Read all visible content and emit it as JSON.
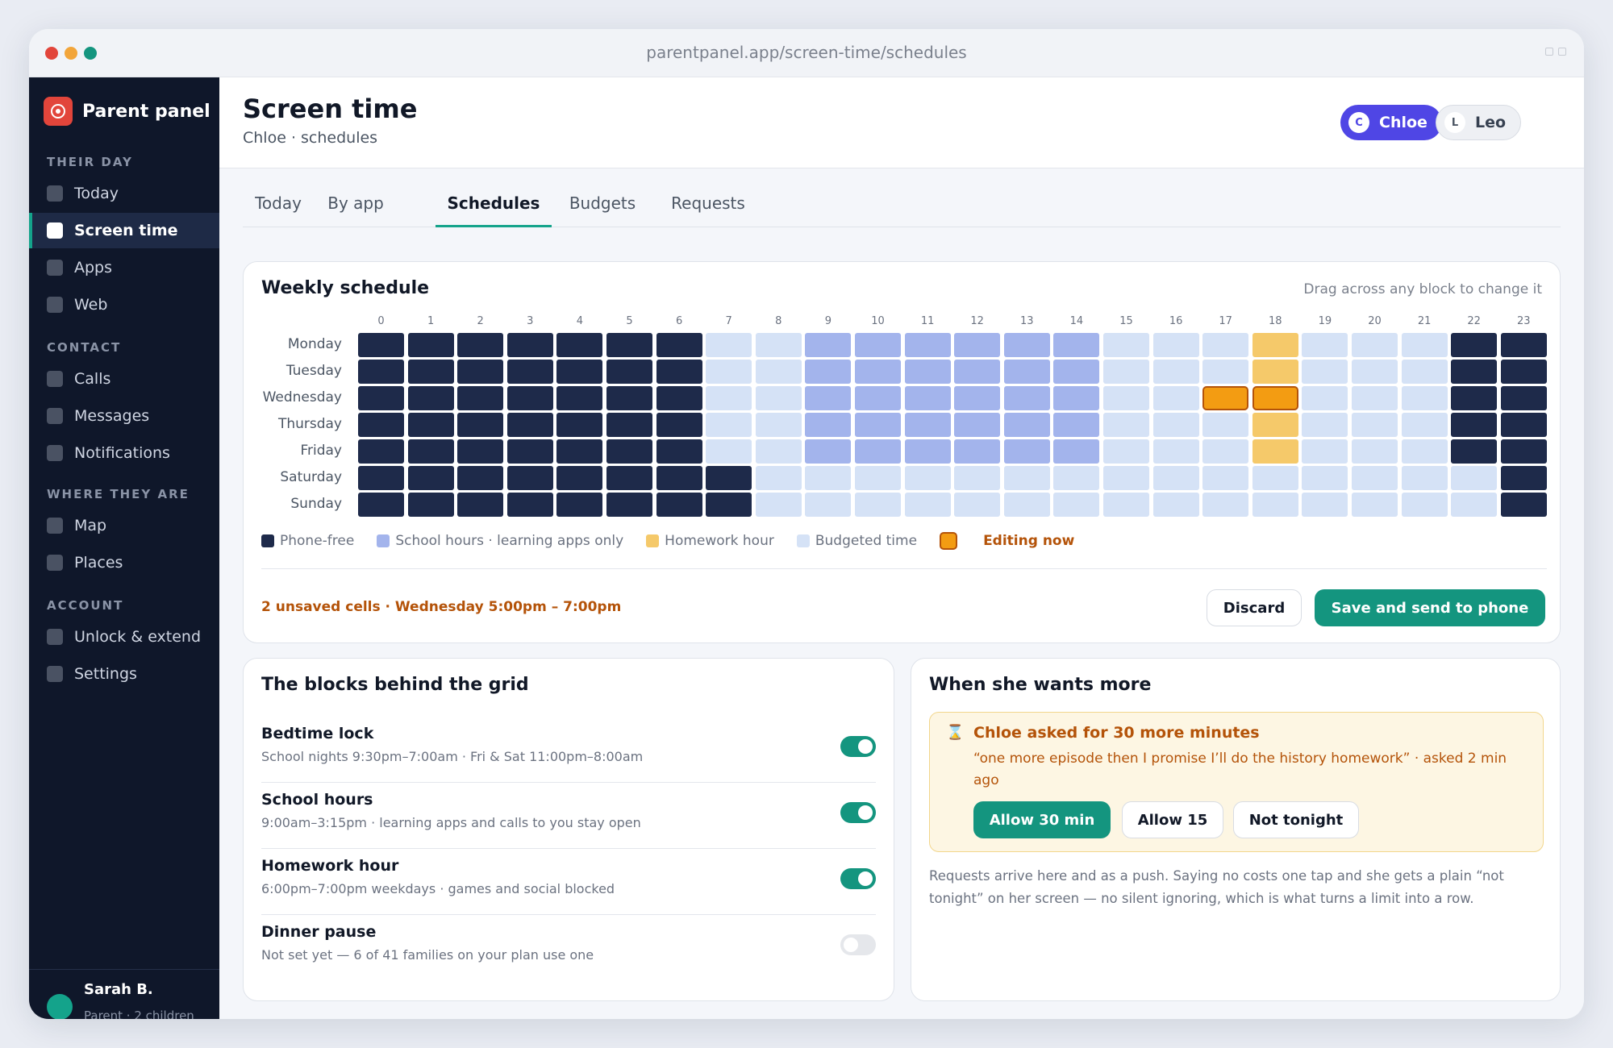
{
  "browser": {
    "url": "parentpanel.app/screen-time/schedules"
  },
  "app": {
    "name": "Parent panel"
  },
  "sidebar": {
    "sections": [
      {
        "title": "THEIR DAY",
        "items": [
          {
            "label": "Today"
          },
          {
            "label": "Screen time",
            "active": true
          },
          {
            "label": "Apps"
          },
          {
            "label": "Web"
          }
        ]
      },
      {
        "title": "CONTACT",
        "items": [
          {
            "label": "Calls"
          },
          {
            "label": "Messages"
          },
          {
            "label": "Notifications"
          }
        ]
      },
      {
        "title": "WHERE THEY ARE",
        "items": [
          {
            "label": "Map"
          },
          {
            "label": "Places"
          }
        ]
      },
      {
        "title": "ACCOUNT",
        "items": [
          {
            "label": "Unlock & extend"
          },
          {
            "label": "Settings"
          }
        ]
      }
    ],
    "user": {
      "name": "Sarah B.",
      "role": "Parent · 2 children"
    }
  },
  "header": {
    "title": "Screen time",
    "subtitle": "Chloe · schedules",
    "children": [
      {
        "initial": "C",
        "name": "Chloe",
        "selected": true
      },
      {
        "initial": "L",
        "name": "Leo",
        "selected": false
      }
    ]
  },
  "tabs": [
    {
      "label": "Today"
    },
    {
      "label": "By app"
    },
    {
      "label": "Schedules",
      "active": true
    },
    {
      "label": "Budgets"
    },
    {
      "label": "Requests"
    }
  ],
  "schedule": {
    "title": "Weekly schedule",
    "hint": "Drag across any block to change it",
    "hours": [
      "0",
      "1",
      "2",
      "3",
      "4",
      "5",
      "6",
      "7",
      "8",
      "9",
      "10",
      "11",
      "12",
      "13",
      "14",
      "15",
      "16",
      "17",
      "18",
      "19",
      "20",
      "21",
      "22",
      "23"
    ],
    "days": [
      "Monday",
      "Tuesday",
      "Wednesday",
      "Thursday",
      "Friday",
      "Saturday",
      "Sunday"
    ],
    "rows": [
      "PPPPPPPBBSSSSSSBBBHBBBPP",
      "PPPPPPPBBSSSSSSBBBHBBBPP",
      "PPPPPPPBBSSSSSSBBEEBBBPP",
      "PPPPPPPBBSSSSSSBBBHBBBPP",
      "PPPPPPPBBSSSSSSBBBHBBBPP",
      "PPPPPPPPBBBBBBBBBBBBBBBP",
      "PPPPPPPPBBBBBBBBBBBBBBBP"
    ],
    "legend": [
      {
        "key": "P",
        "label": "Phone-free",
        "color": "#1e2a4a"
      },
      {
        "key": "S",
        "label": "School hours · learning apps only",
        "color": "#a3b4ec"
      },
      {
        "key": "H",
        "label": "Homework hour",
        "color": "#f5c96a"
      },
      {
        "key": "B",
        "label": "Budgeted time",
        "color": "#d5e2f6"
      },
      {
        "key": "E",
        "label": "Editing now",
        "color": "#f39c12"
      }
    ],
    "unsaved": "2 unsaved cells · Wednesday 5:00pm – 7:00pm",
    "discard_label": "Discard",
    "save_label": "Save and send to phone"
  },
  "blocks": {
    "title": "The blocks behind the grid",
    "items": [
      {
        "name": "Bedtime lock",
        "detail": "School nights 9:30pm–7:00am · Fri & Sat 11:00pm–8:00am",
        "enabled": true
      },
      {
        "name": "School hours",
        "detail": "9:00am–3:15pm · learning apps and calls to you stay open",
        "enabled": true
      },
      {
        "name": "Homework hour",
        "detail": "6:00pm–7:00pm weekdays · games and social blocked",
        "enabled": true
      },
      {
        "name": "Dinner pause",
        "detail": "Not set yet — 6 of 41 families on your plan use one",
        "enabled": false
      }
    ]
  },
  "requests": {
    "title": "When she wants more",
    "request_icon": "hourglass-icon",
    "request_title": "Chloe asked for 30 more minutes",
    "request_quote": "“one more episode then I promise I’ll do the history homework” · asked 2 min ago",
    "allow30_label": "Allow 30 min",
    "allow15_label": "Allow 15",
    "decline_label": "Not tonight",
    "note": "Requests arrive here and as a push. Saying no costs one tap and she gets a plain “not tonight” on her screen — no silent ignoring, which is what turns a limit into a row."
  },
  "colors": {
    "accent": "#14957f",
    "child_selected": "#4f46e5",
    "warning": "#b45309"
  }
}
